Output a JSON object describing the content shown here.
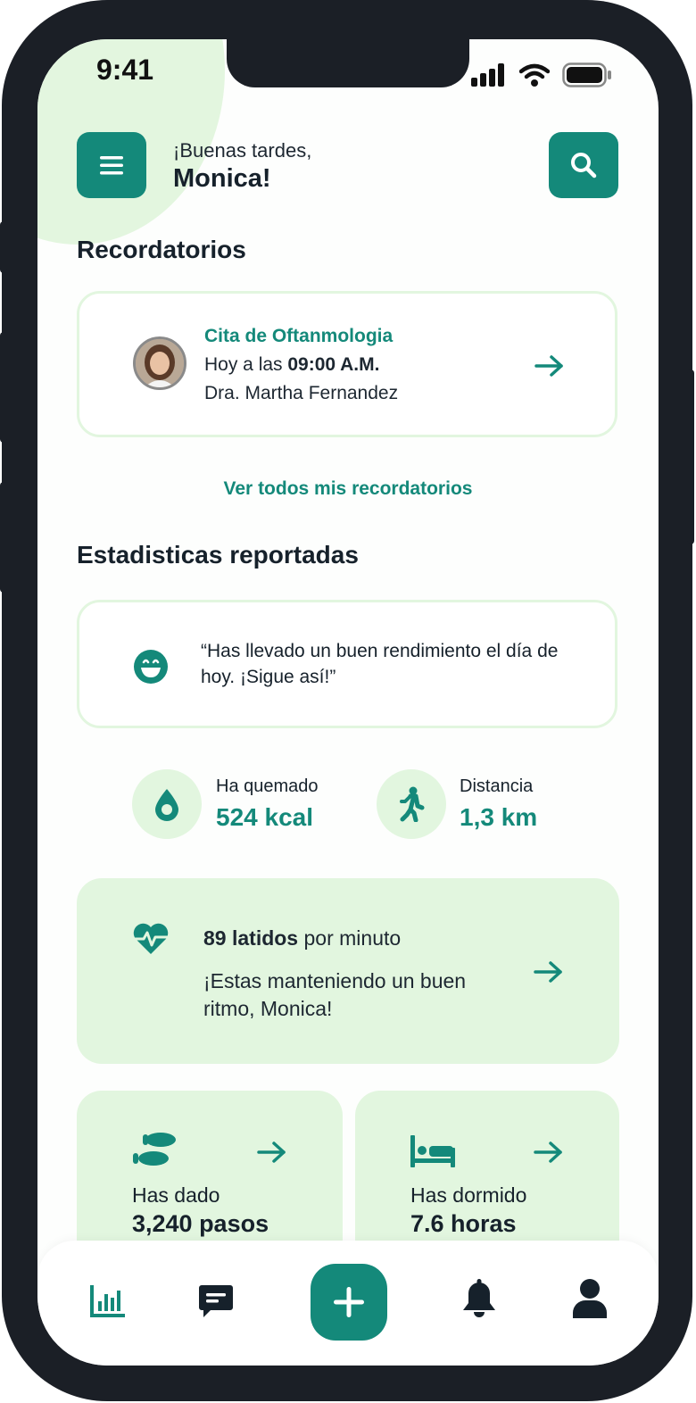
{
  "status_bar": {
    "time": "9:41"
  },
  "header": {
    "greeting": "¡Buenas tardes,",
    "name": "Monica!"
  },
  "reminders": {
    "section_title": "Recordatorios",
    "card": {
      "title": "Cita de Oftanmologia",
      "time_prefix": "Hoy a las ",
      "time": "09:00 A.M.",
      "doctor": "Dra. Martha Fernandez"
    },
    "see_all_link": "Ver todos mis recordatorios"
  },
  "stats": {
    "section_title": "Estadisticas reportadas",
    "quote": "“Has llevado un buen rendimiento el día de hoy. ¡Sigue así!”",
    "calories": {
      "label": "Ha quemado",
      "value": "524 kcal"
    },
    "distance": {
      "label": "Distancia",
      "value": "1,3 km"
    },
    "heart": {
      "bpm": "89 latidos",
      "bpm_suffix": " por minuto",
      "message": "¡Estas manteniendo un buen ritmo, Monica!"
    },
    "steps": {
      "label": "Has dado",
      "value": "3,240 pasos"
    },
    "sleep": {
      "label": "Has dormido",
      "value": "7.6 horas"
    }
  },
  "bottom_nav": {
    "items": [
      "stats-icon",
      "chat-icon",
      "plus-icon",
      "bell-icon",
      "user-icon"
    ],
    "active": "stats-icon"
  },
  "colors": {
    "accent": "#14897a",
    "accent_light": "#e2f6df",
    "text": "#16212b"
  }
}
